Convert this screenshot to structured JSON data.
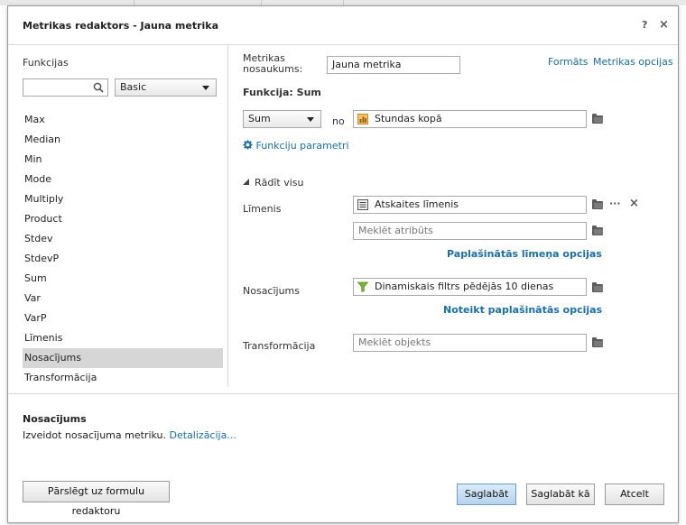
{
  "dialog": {
    "title": "Metrikas redaktors - Jauna metrika",
    "help": "?",
    "close": "×"
  },
  "left": {
    "heading": "Funkcijas",
    "search_value": "",
    "category": "Basic",
    "functions": [
      "Max",
      "Median",
      "Min",
      "Mode",
      "Multiply",
      "Product",
      "Stdev",
      "StdevP",
      "Sum",
      "Var",
      "VarP",
      "Līmenis",
      "Nosacījums",
      "Transformācija"
    ],
    "selected_index": 12
  },
  "right": {
    "name_label": "Metrikas nosaukums:",
    "name_value": "Jauna metrika",
    "link_format": "Formāts",
    "link_options": "Metrikas opcijas",
    "function_heading": "Funkcija: Sum",
    "func_select": "Sum",
    "no_label": "no",
    "metric_value": "Stundas kopā",
    "func_params": "Funkciju parametri",
    "show_all": "Rādīt visu",
    "level_label": "Līmenis",
    "level_value": "Atskaites līmenis",
    "level_more": "···",
    "level_remove": "×",
    "attr_placeholder": "Meklēt atribūts",
    "level_adv": "Paplašinātās līmeņa opcijas",
    "cond_label": "Nosacījums",
    "cond_value": "Dinamiskais filtrs pēdējās 10 dienas",
    "cond_adv": "Noteikt paplašinātās opcijas",
    "trans_label": "Transformācija",
    "trans_placeholder": "Meklēt objekts"
  },
  "description": {
    "title": "Nosacījums",
    "text": "Izveidot nosacījuma metriku.",
    "link": "Detalizācija..."
  },
  "footer": {
    "switch": "Pārslēgt uz formulu redaktoru",
    "save": "Saglabāt",
    "save_as": "Saglabāt kā",
    "cancel": "Atcelt"
  },
  "colors": {
    "link": "#1a6fa8",
    "selected_row": "#d6d6d6",
    "primary_button": "#b6d3ee",
    "metric_icon": "#e8a33a",
    "filter_icon": "#7cb82f"
  }
}
